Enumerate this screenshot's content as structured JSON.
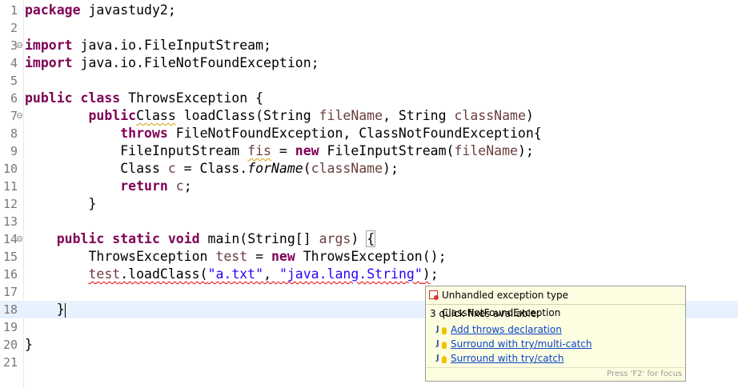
{
  "editor": {
    "lines": [
      {
        "n": "1",
        "tokens": [
          [
            "kw",
            "package"
          ],
          [
            "",
            "javastudy2;"
          ]
        ]
      },
      {
        "n": "2",
        "tokens": []
      },
      {
        "n": "3",
        "tokens": [
          [
            "kw",
            "import"
          ],
          [
            "",
            "java.io.FileInputStream;"
          ]
        ]
      },
      {
        "n": "4",
        "tokens": [
          [
            "kw",
            "import"
          ],
          [
            "",
            "java.io.FileNotFoundException;"
          ]
        ]
      },
      {
        "n": "5",
        "tokens": []
      },
      {
        "n": "6",
        "tokens": [
          [
            "kw",
            "public"
          ],
          [
            "kw",
            "class"
          ],
          [
            "",
            "ThrowsException {"
          ]
        ]
      },
      {
        "n": "7",
        "tokens": [
          [
            "",
            "        "
          ],
          [
            "kw",
            "public"
          ],
          [
            "",
            ""
          ],
          [
            "warn",
            "Class"
          ],
          [
            "",
            " loadClass(String "
          ],
          [
            "var",
            "fileName"
          ],
          [
            "",
            ", String "
          ],
          [
            "var",
            "className"
          ],
          [
            "",
            ")"
          ]
        ]
      },
      {
        "n": "8",
        "tokens": [
          [
            "",
            "            "
          ],
          [
            "kw",
            "throws"
          ],
          [
            "",
            " FileNotFoundException, ClassNotFoundException{"
          ]
        ]
      },
      {
        "n": "9",
        "tokens": [
          [
            "",
            "            FileInputStream "
          ],
          [
            "warnvar",
            "fis"
          ],
          [
            "",
            " = "
          ],
          [
            "kw",
            "new"
          ],
          [
            "",
            " FileInputStream("
          ],
          [
            "var",
            "fileName"
          ],
          [
            "",
            ");"
          ]
        ]
      },
      {
        "n": "10",
        "tokens": [
          [
            "",
            "            Class "
          ],
          [
            "var",
            "c"
          ],
          [
            "",
            " = Class."
          ],
          [
            "it",
            "forName"
          ],
          [
            "",
            "("
          ],
          [
            "var",
            "className"
          ],
          [
            "",
            ");"
          ]
        ]
      },
      {
        "n": "11",
        "tokens": [
          [
            "",
            "            "
          ],
          [
            "kw",
            "return"
          ],
          [
            "",
            " "
          ],
          [
            "var",
            "c"
          ],
          [
            "",
            ";"
          ]
        ]
      },
      {
        "n": "12",
        "tokens": [
          [
            "",
            "        }"
          ]
        ]
      },
      {
        "n": "13",
        "tokens": []
      },
      {
        "n": "14",
        "tokens": [
          [
            "",
            "    "
          ],
          [
            "kw",
            "public"
          ],
          [
            "",
            " "
          ],
          [
            "kw",
            "static"
          ],
          [
            "",
            " "
          ],
          [
            "kw",
            "void"
          ],
          [
            "",
            " main(String[] "
          ],
          [
            "var",
            "args"
          ],
          [
            "",
            ") "
          ],
          [
            "bracket",
            "{"
          ]
        ]
      },
      {
        "n": "15",
        "tokens": [
          [
            "",
            "        ThrowsException "
          ],
          [
            "var",
            "test"
          ],
          [
            "",
            " = "
          ],
          [
            "kw",
            "new"
          ],
          [
            "",
            " ThrowsException();"
          ]
        ]
      },
      {
        "n": "16",
        "tokens": [
          [
            "",
            "        "
          ],
          [
            "errvar",
            "test"
          ],
          [
            "err",
            ".loadClass("
          ],
          [
            "errstr",
            "\"a.txt\""
          ],
          [
            "err",
            ", "
          ],
          [
            "errstr",
            "\"java.lang.String\""
          ],
          [
            "err",
            ")"
          ],
          [
            "",
            ";"
          ]
        ]
      },
      {
        "n": "17",
        "tokens": []
      },
      {
        "n": "18",
        "tokens": [
          [
            "",
            "    }"
          ],
          [
            "caret",
            ""
          ]
        ]
      },
      {
        "n": "19",
        "tokens": []
      },
      {
        "n": "20",
        "tokens": [
          [
            "",
            "}"
          ]
        ]
      },
      {
        "n": "21",
        "tokens": []
      }
    ],
    "fold_lines": [
      "3",
      "7",
      "14"
    ],
    "current_line": "18"
  },
  "quickfix": {
    "title": "Unhandled exception type ClassNotFoundException",
    "subtitle": "3 quick fixes available:",
    "fixes": [
      {
        "label": "Add throws declaration"
      },
      {
        "label": "Surround with try/multi-catch"
      },
      {
        "label": "Surround with try/catch"
      }
    ],
    "footer": "Press 'F2' for focus"
  },
  "colors": {
    "keyword": "#7f0055",
    "variable": "#6a3e3e",
    "string": "#2a00ff",
    "error_underline": "#e00000",
    "current_line": "#e8f2fe",
    "popup_bg": "#fdfde1",
    "link": "#0b44cc"
  }
}
